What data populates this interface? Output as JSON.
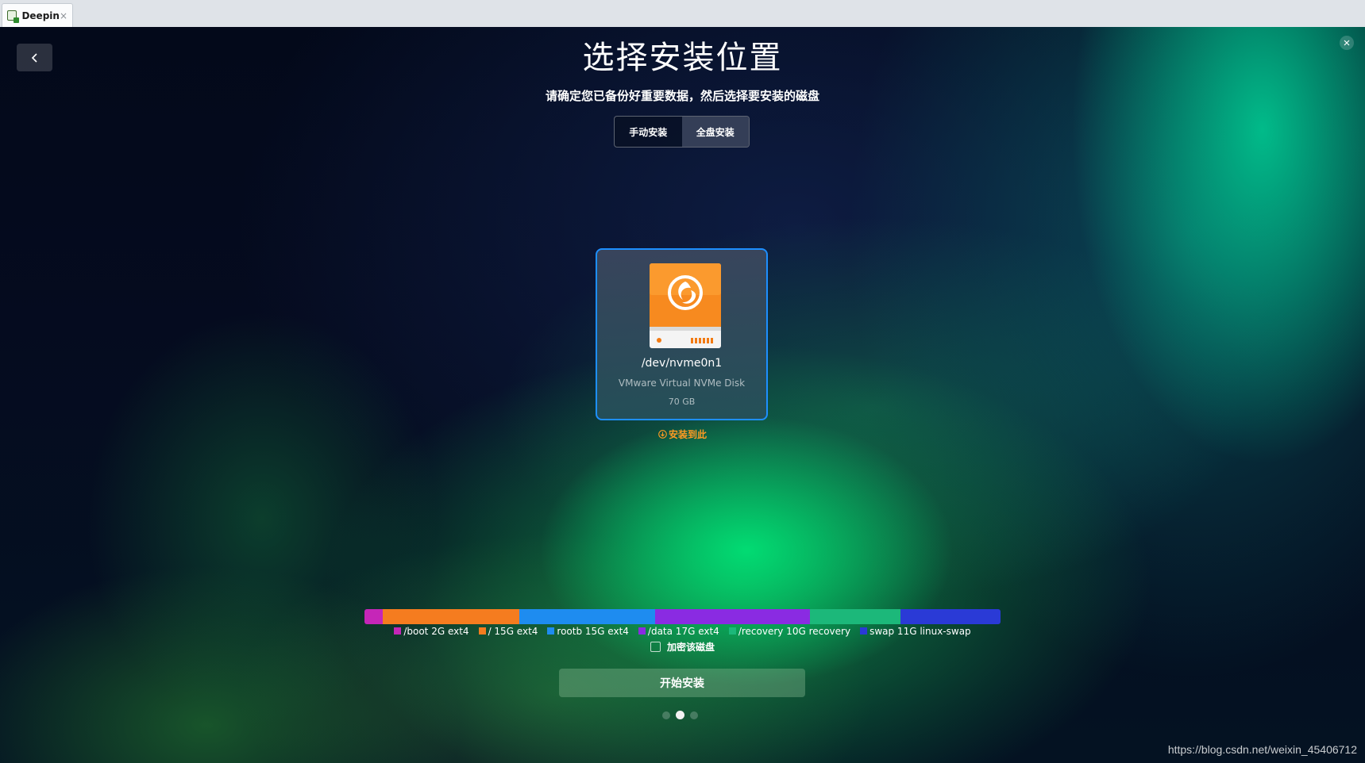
{
  "host": {
    "tab_title": "Deepin",
    "tab_close": "×"
  },
  "installer": {
    "title": "选择安装位置",
    "subtitle": "请确定您已备份好重要数据，然后选择要安装的磁盘",
    "modes": [
      {
        "label": "手动安装",
        "active": false
      },
      {
        "label": "全盘安装",
        "active": true
      }
    ],
    "disk": {
      "device": "/dev/nvme0n1",
      "model": "VMware Virtual NVMe Disk",
      "size": "70 GB",
      "icon": "hard-disk-deepin-icon"
    },
    "install_here_label": "安装到此",
    "partitions": [
      {
        "label": "/boot 2G ext4",
        "size_gb": 2,
        "color": "#c526b8"
      },
      {
        "label": "/ 15G ext4",
        "size_gb": 15,
        "color": "#f57c1f"
      },
      {
        "label": "rootb 15G ext4",
        "size_gb": 15,
        "color": "#1e8cf0"
      },
      {
        "label": "/data 17G ext4",
        "size_gb": 17,
        "color": "#8a2be2"
      },
      {
        "label": "/recovery 10G recovery",
        "size_gb": 10,
        "color": "#1cb87a"
      },
      {
        "label": "swap 11G linux-swap",
        "size_gb": 11,
        "color": "#2a3ad6"
      }
    ],
    "encrypt_label": "加密该磁盘",
    "encrypt_checked": false,
    "start_button": "开始安装",
    "pager": {
      "count": 3,
      "active_index": 1
    }
  },
  "watermark": "https://blog.csdn.net/weixin_45406712"
}
